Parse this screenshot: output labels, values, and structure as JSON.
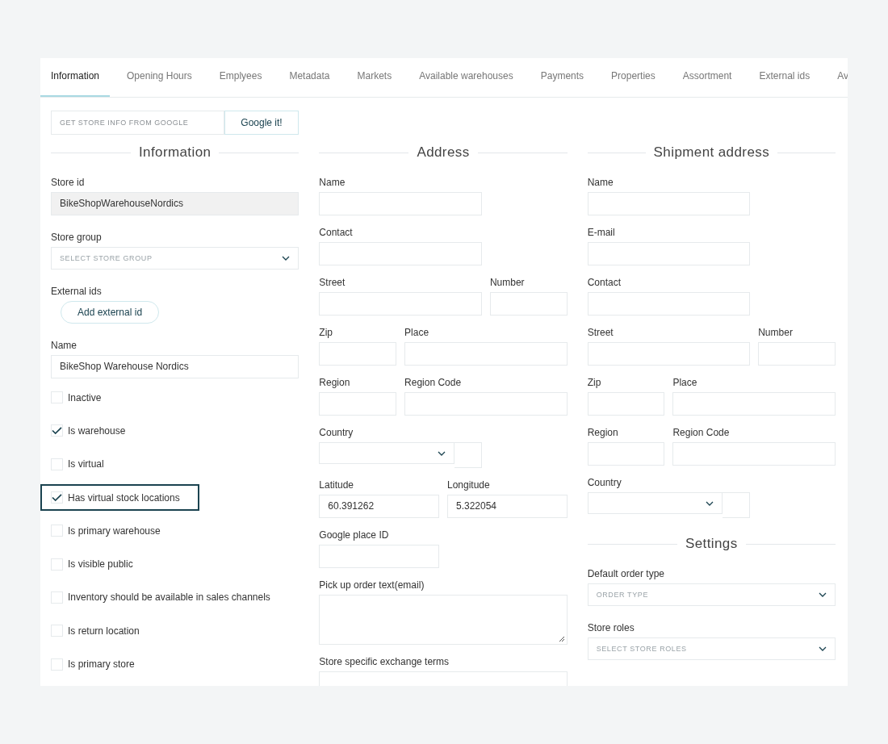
{
  "tabs": [
    {
      "label": "Information",
      "selected": true
    },
    {
      "label": "Opening Hours",
      "selected": false
    },
    {
      "label": "Emplyees",
      "selected": false
    },
    {
      "label": "Metadata",
      "selected": false
    },
    {
      "label": "Markets",
      "selected": false
    },
    {
      "label": "Available warehouses",
      "selected": false
    },
    {
      "label": "Payments",
      "selected": false
    },
    {
      "label": "Properties",
      "selected": false
    },
    {
      "label": "Assortment",
      "selected": false
    },
    {
      "label": "External ids",
      "selected": false
    },
    {
      "label": "Av",
      "selected": false
    }
  ],
  "google_search": {
    "placeholder": "GET STORE INFO FROM GOOGLE",
    "button": "Google it!"
  },
  "information": {
    "title": "Information",
    "store_id": {
      "label": "Store id",
      "value": "BikeShopWarehouseNordics",
      "disabled": true
    },
    "store_group": {
      "label": "Store group",
      "placeholder": "SELECT STORE GROUP"
    },
    "external_ids": {
      "label": "External ids",
      "button": "Add external id"
    },
    "name": {
      "label": "Name",
      "value": "BikeShop Warehouse Nordics"
    },
    "checkboxes": [
      {
        "label": "Inactive",
        "checked": false,
        "focused": false
      },
      {
        "label": "Is warehouse",
        "checked": true,
        "focused": false
      },
      {
        "label": "Is virtual",
        "checked": false,
        "focused": false
      },
      {
        "label": "Has virtual stock locations",
        "checked": true,
        "focused": true
      },
      {
        "label": "Is primary warehouse",
        "checked": false,
        "focused": false
      },
      {
        "label": "Is visible public",
        "checked": false,
        "focused": false
      },
      {
        "label": "Inventory should be available in sales channels",
        "checked": false,
        "focused": false
      },
      {
        "label": "Is return location",
        "checked": false,
        "focused": false
      },
      {
        "label": "Is primary store",
        "checked": false,
        "focused": false
      }
    ]
  },
  "address": {
    "title": "Address",
    "fields": [
      {
        "label": "Name",
        "kind": "wide"
      },
      {
        "label": "Contact",
        "kind": "wide"
      },
      {
        "label": "Street",
        "kind": "wide"
      },
      {
        "label": "Number",
        "kind": "narrow"
      },
      {
        "label": "Zip",
        "kind": "narrow"
      },
      {
        "label": "Place",
        "kind": "wide"
      },
      {
        "label": "Region",
        "kind": "narrow"
      },
      {
        "label": "Region Code",
        "kind": "wide"
      },
      {
        "label": "Country",
        "kind": "country"
      },
      {
        "label": "Latitude",
        "kind": "half",
        "value": "60.391262"
      },
      {
        "label": "Longitude",
        "kind": "half",
        "value": "5.322054"
      },
      {
        "label": "Google place ID",
        "kind": "half"
      },
      {
        "label": "Pick up order text(email)",
        "kind": "textarea"
      },
      {
        "label": "Store specific exchange terms",
        "kind": "full"
      }
    ]
  },
  "shipment_address": {
    "title": "Shipment address",
    "fields": [
      {
        "label": "Name",
        "kind": "wide"
      },
      {
        "label": "E-mail",
        "kind": "wide"
      },
      {
        "label": "Contact",
        "kind": "wide"
      },
      {
        "label": "Street",
        "kind": "wide"
      },
      {
        "label": "Number",
        "kind": "narrow"
      },
      {
        "label": "Zip",
        "kind": "narrow"
      },
      {
        "label": "Place",
        "kind": "wide"
      },
      {
        "label": "Region",
        "kind": "narrow"
      },
      {
        "label": "Region Code",
        "kind": "wide"
      },
      {
        "label": "Country",
        "kind": "country"
      }
    ]
  },
  "settings": {
    "title": "Settings",
    "fields": [
      {
        "label": "Default order type",
        "placeholder": "ORDER TYPE"
      },
      {
        "label": "Store roles",
        "placeholder": "SELECT STORE ROLES"
      }
    ]
  }
}
